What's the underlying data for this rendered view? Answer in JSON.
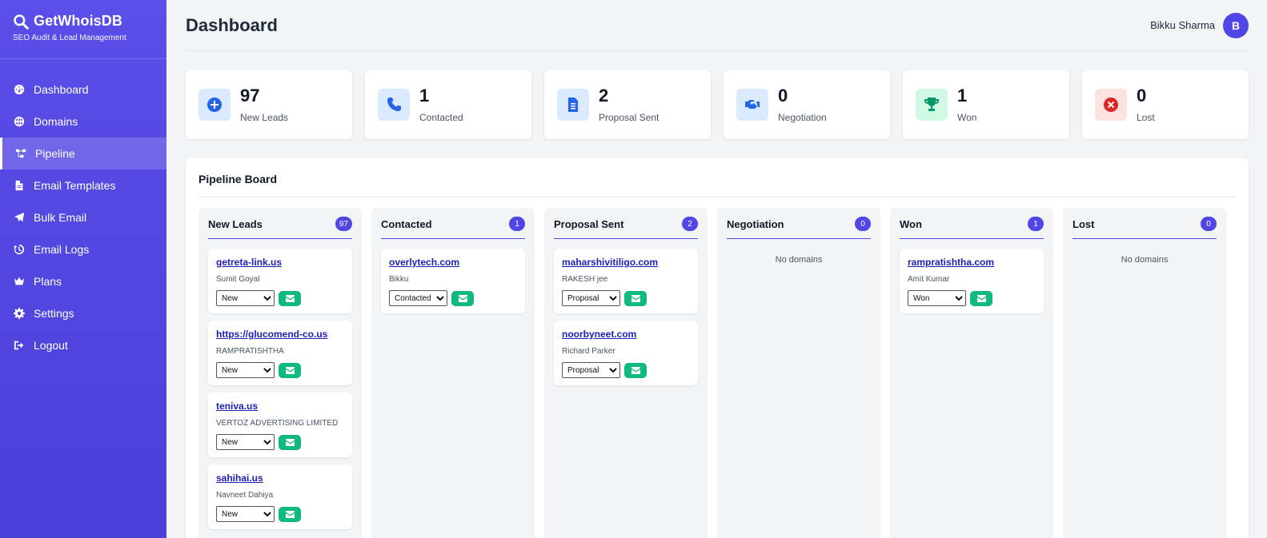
{
  "brand": {
    "title": "GetWhoisDB",
    "subtitle": "SEO Audit & Lead Management"
  },
  "nav": [
    {
      "label": "Dashboard",
      "icon": "gauge-icon"
    },
    {
      "label": "Domains",
      "icon": "globe-icon"
    },
    {
      "label": "Pipeline",
      "icon": "sitemap-icon",
      "active": true
    },
    {
      "label": "Email Templates",
      "icon": "file-icon"
    },
    {
      "label": "Bulk Email",
      "icon": "paper-plane-icon"
    },
    {
      "label": "Email Logs",
      "icon": "history-icon"
    },
    {
      "label": "Plans",
      "icon": "crown-icon"
    },
    {
      "label": "Settings",
      "icon": "gear-icon"
    },
    {
      "label": "Logout",
      "icon": "logout-icon"
    }
  ],
  "header": {
    "title": "Dashboard",
    "user_name": "Bikku Sharma",
    "avatar_initial": "B"
  },
  "stats": [
    {
      "value": "97",
      "label": "New Leads",
      "icon": "plus-circle-icon",
      "color": "#2563eb",
      "bg": "#dbeafe"
    },
    {
      "value": "1",
      "label": "Contacted",
      "icon": "phone-icon",
      "color": "#2563eb",
      "bg": "#dbeafe"
    },
    {
      "value": "2",
      "label": "Proposal Sent",
      "icon": "document-icon",
      "color": "#2563eb",
      "bg": "#dbeafe"
    },
    {
      "value": "0",
      "label": "Negotiation",
      "icon": "handshake-icon",
      "color": "#2563eb",
      "bg": "#dbeafe"
    },
    {
      "value": "1",
      "label": "Won",
      "icon": "trophy-icon",
      "color": "#059669",
      "bg": "#d1fae5"
    },
    {
      "value": "0",
      "label": "Lost",
      "icon": "x-circle-icon",
      "color": "#dc2626",
      "bg": "#fee2e2"
    }
  ],
  "board": {
    "title": "Pipeline Board",
    "empty_text": "No domains",
    "columns": [
      {
        "title": "New Leads",
        "count": "97",
        "cards": [
          {
            "domain": "getreta-link.us",
            "contact": "Sumit Goyal",
            "status": "New"
          },
          {
            "domain": "https://glucomend-co.us",
            "contact": "RAMPRATISHTHA",
            "status": "New"
          },
          {
            "domain": "teniva.us",
            "contact": "VERTOZ ADVERTISING LIMITED",
            "status": "New"
          },
          {
            "domain": "sahihai.us",
            "contact": "Navneet Dahiya",
            "status": "New"
          }
        ]
      },
      {
        "title": "Contacted",
        "count": "1",
        "cards": [
          {
            "domain": "overlytech.com",
            "contact": "Bikku",
            "status": "Contacted"
          }
        ]
      },
      {
        "title": "Proposal Sent",
        "count": "2",
        "cards": [
          {
            "domain": "maharshivitiligo.com",
            "contact": "RAKESH jee",
            "status": "Proposal"
          },
          {
            "domain": "noorbyneet.com",
            "contact": "Richard Parker",
            "status": "Proposal"
          }
        ]
      },
      {
        "title": "Negotiation",
        "count": "0",
        "cards": []
      },
      {
        "title": "Won",
        "count": "1",
        "cards": [
          {
            "domain": "rampratishtha.com",
            "contact": "Amit Kumar",
            "status": "Won"
          }
        ]
      },
      {
        "title": "Lost",
        "count": "0",
        "cards": []
      }
    ]
  }
}
